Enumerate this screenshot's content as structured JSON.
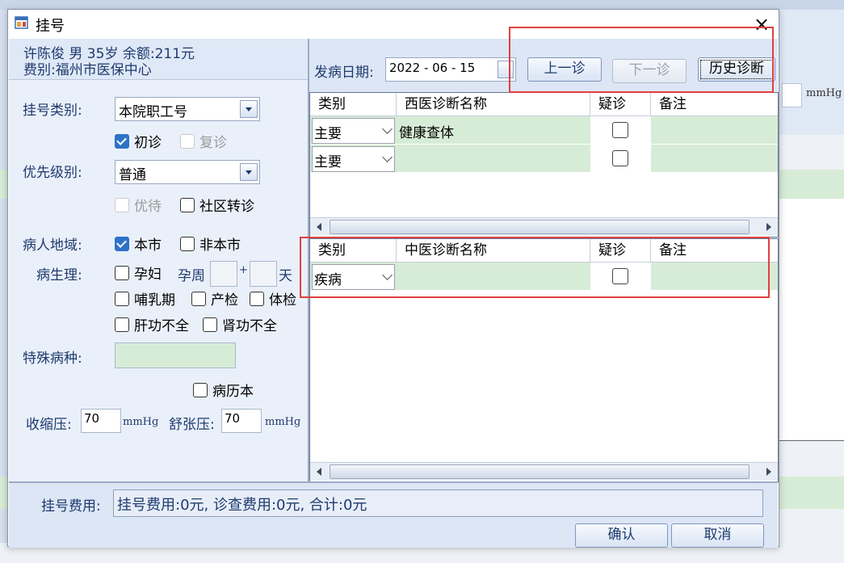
{
  "window": {
    "title": "挂号",
    "close": "×"
  },
  "patient": {
    "line1": "许陈俊 男 35岁 余额:211元",
    "line2": "费别:福州市医保中心"
  },
  "form": {
    "reg_type_label": "挂号类别:",
    "reg_type_value": "本院职工号",
    "first_visit": "初诊",
    "re_visit": "复诊",
    "priority_label": "优先级别:",
    "priority_value": "普通",
    "preferential": "优待",
    "community_referral": "社区转诊",
    "region_label": "病人地域:",
    "local": "本市",
    "nonlocal": "非本市",
    "physio_label": "病生理:",
    "pregnant": "孕妇",
    "gest_week_label": "孕周",
    "plus": "+",
    "day_label": "天",
    "lactation": "哺乳期",
    "prenatal": "产检",
    "physical_exam": "体检",
    "liver": "肝功不全",
    "kidney": "肾功不全",
    "special_label": "特殊病种:",
    "record_book": "病历本",
    "systolic_label": "收缩压:",
    "systolic_value": "70",
    "diastolic_label": "舒张压:",
    "diastolic_value": "70",
    "unit": "mmHg"
  },
  "toolbar": {
    "onset_label": "发病日期:",
    "onset_date": "2022 - 06 - 15",
    "prev_visit": "上一诊",
    "next_visit": "下一诊",
    "history": "历史诊断"
  },
  "western_grid": {
    "headers": [
      "类别",
      "西医诊断名称",
      "疑诊",
      "备注"
    ],
    "rows": [
      {
        "type": "主要",
        "name": "健康查体"
      },
      {
        "type": "主要",
        "name": ""
      }
    ]
  },
  "tcm_grid": {
    "headers": [
      "类别",
      "中医诊断名称",
      "疑诊",
      "备注"
    ],
    "rows": [
      {
        "type": "疾病",
        "name": ""
      }
    ]
  },
  "fee": {
    "label": "挂号费用:",
    "text": "挂号费用:0元, 诊查费用:0元, 合计:0元"
  },
  "buttons": {
    "ok": "确认",
    "cancel": "取消"
  },
  "background": {
    "unit": "mmHg"
  },
  "colors": {
    "highlight": "#e04040",
    "row_green": "#d7ecd6",
    "text_blue": "#1e3a6e"
  }
}
